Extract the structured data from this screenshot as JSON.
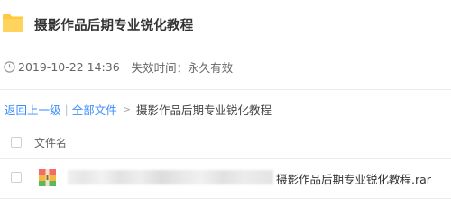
{
  "share": {
    "title": "摄影作品后期专业锐化教程",
    "date": "2019-10-22 14:36",
    "expire_label": "失效时间：",
    "expire_value": "永久有效"
  },
  "breadcrumb": {
    "back": "返回上一级",
    "all_files": "全部文件",
    "current": "摄影作品后期专业锐化教程"
  },
  "file_list": {
    "header_name": "文件名",
    "items": [
      {
        "name": "摄影作品后期专业锐化教程.rar",
        "icon": "rar-archive-icon"
      }
    ]
  },
  "colors": {
    "link": "#3b8cff",
    "folder": "#ffc93d"
  }
}
